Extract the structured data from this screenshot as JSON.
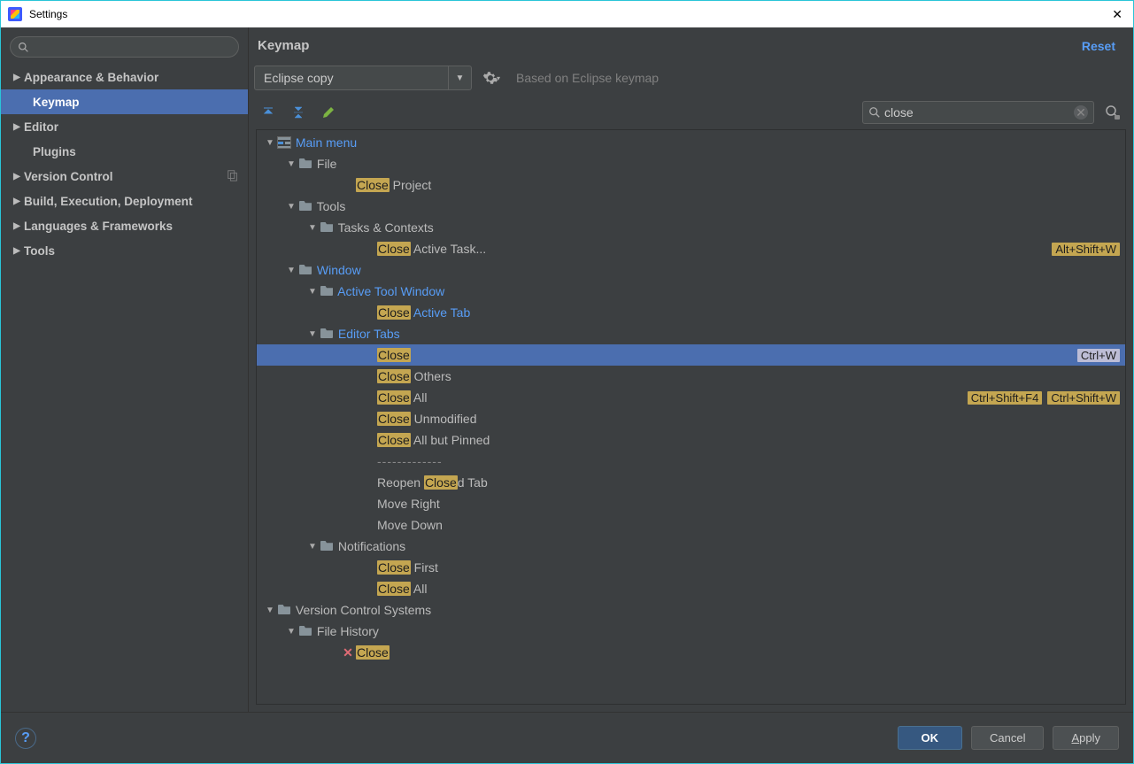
{
  "window": {
    "title": "Settings"
  },
  "sidebar": {
    "search_placeholder": "",
    "items": [
      {
        "label": "Appearance & Behavior",
        "expandable": true
      },
      {
        "label": "Keymap",
        "child": true,
        "selected": true
      },
      {
        "label": "Editor",
        "expandable": true
      },
      {
        "label": "Plugins",
        "child": true
      },
      {
        "label": "Version Control",
        "expandable": true,
        "badge": true
      },
      {
        "label": "Build, Execution, Deployment",
        "expandable": true
      },
      {
        "label": "Languages & Frameworks",
        "expandable": true
      },
      {
        "label": "Tools",
        "expandable": true
      }
    ]
  },
  "panel": {
    "title": "Keymap",
    "reset": "Reset",
    "keymap_select": "Eclipse copy",
    "based_on": "Based on Eclipse keymap",
    "search_value": "close"
  },
  "tree": [
    {
      "depth": 0,
      "arrow": true,
      "icon": "menu",
      "label": "Main menu",
      "link": true
    },
    {
      "depth": 1,
      "arrow": true,
      "icon": "folder",
      "label": "File"
    },
    {
      "depth": 3,
      "parts": [
        {
          "hl": true,
          "t": "Close"
        },
        {
          "t": " Project"
        }
      ]
    },
    {
      "depth": 1,
      "arrow": true,
      "icon": "folder",
      "label": "Tools"
    },
    {
      "depth": 2,
      "arrow": true,
      "icon": "folder",
      "label": "Tasks & Contexts"
    },
    {
      "depth": 4,
      "parts": [
        {
          "hl": true,
          "t": "Close"
        },
        {
          "t": " Active Task..."
        }
      ],
      "shortcuts": [
        "Alt+Shift+W"
      ]
    },
    {
      "depth": 1,
      "arrow": true,
      "icon": "folder",
      "label": "Window",
      "link": true
    },
    {
      "depth": 2,
      "arrow": true,
      "icon": "folder",
      "label": "Active Tool Window",
      "link": true
    },
    {
      "depth": 4,
      "parts": [
        {
          "hl": true,
          "t": "Close"
        },
        {
          "t": " Active Tab",
          "link": true
        }
      ]
    },
    {
      "depth": 2,
      "arrow": true,
      "icon": "folder",
      "label": "Editor Tabs",
      "link": true
    },
    {
      "depth": 4,
      "parts": [
        {
          "hl": true,
          "t": "Close"
        }
      ],
      "selected": true,
      "shortcuts": [
        "Ctrl+W"
      ]
    },
    {
      "depth": 4,
      "parts": [
        {
          "hl": true,
          "t": "Close"
        },
        {
          "t": " Others"
        }
      ]
    },
    {
      "depth": 4,
      "parts": [
        {
          "hl": true,
          "t": "Close"
        },
        {
          "t": " All"
        }
      ],
      "shortcuts": [
        "Ctrl+Shift+F4",
        "Ctrl+Shift+W"
      ]
    },
    {
      "depth": 4,
      "parts": [
        {
          "hl": true,
          "t": "Close"
        },
        {
          "t": " Unmodified"
        }
      ]
    },
    {
      "depth": 4,
      "parts": [
        {
          "hl": true,
          "t": "Close"
        },
        {
          "t": " All but Pinned"
        }
      ]
    },
    {
      "depth": 4,
      "separator": true
    },
    {
      "depth": 4,
      "parts": [
        {
          "t": "Reopen "
        },
        {
          "hl": true,
          "t": "Close"
        },
        {
          "t": "d Tab"
        }
      ]
    },
    {
      "depth": 4,
      "parts": [
        {
          "t": "Move Right"
        }
      ]
    },
    {
      "depth": 4,
      "parts": [
        {
          "t": "Move Down"
        }
      ]
    },
    {
      "depth": 2,
      "arrow": true,
      "icon": "folder",
      "label": "Notifications"
    },
    {
      "depth": 4,
      "parts": [
        {
          "hl": true,
          "t": "Close"
        },
        {
          "t": " First"
        }
      ]
    },
    {
      "depth": 4,
      "parts": [
        {
          "hl": true,
          "t": "Close"
        },
        {
          "t": " All"
        }
      ]
    },
    {
      "depth": 0,
      "arrow": true,
      "icon": "folder",
      "label": "Version Control Systems"
    },
    {
      "depth": 1,
      "arrow": true,
      "icon": "folder",
      "label": "File History"
    },
    {
      "depth": 3,
      "icon": "x",
      "parts": [
        {
          "hl": true,
          "t": "Close"
        }
      ]
    }
  ],
  "footer": {
    "ok": "OK",
    "cancel": "Cancel",
    "apply": "Apply"
  }
}
